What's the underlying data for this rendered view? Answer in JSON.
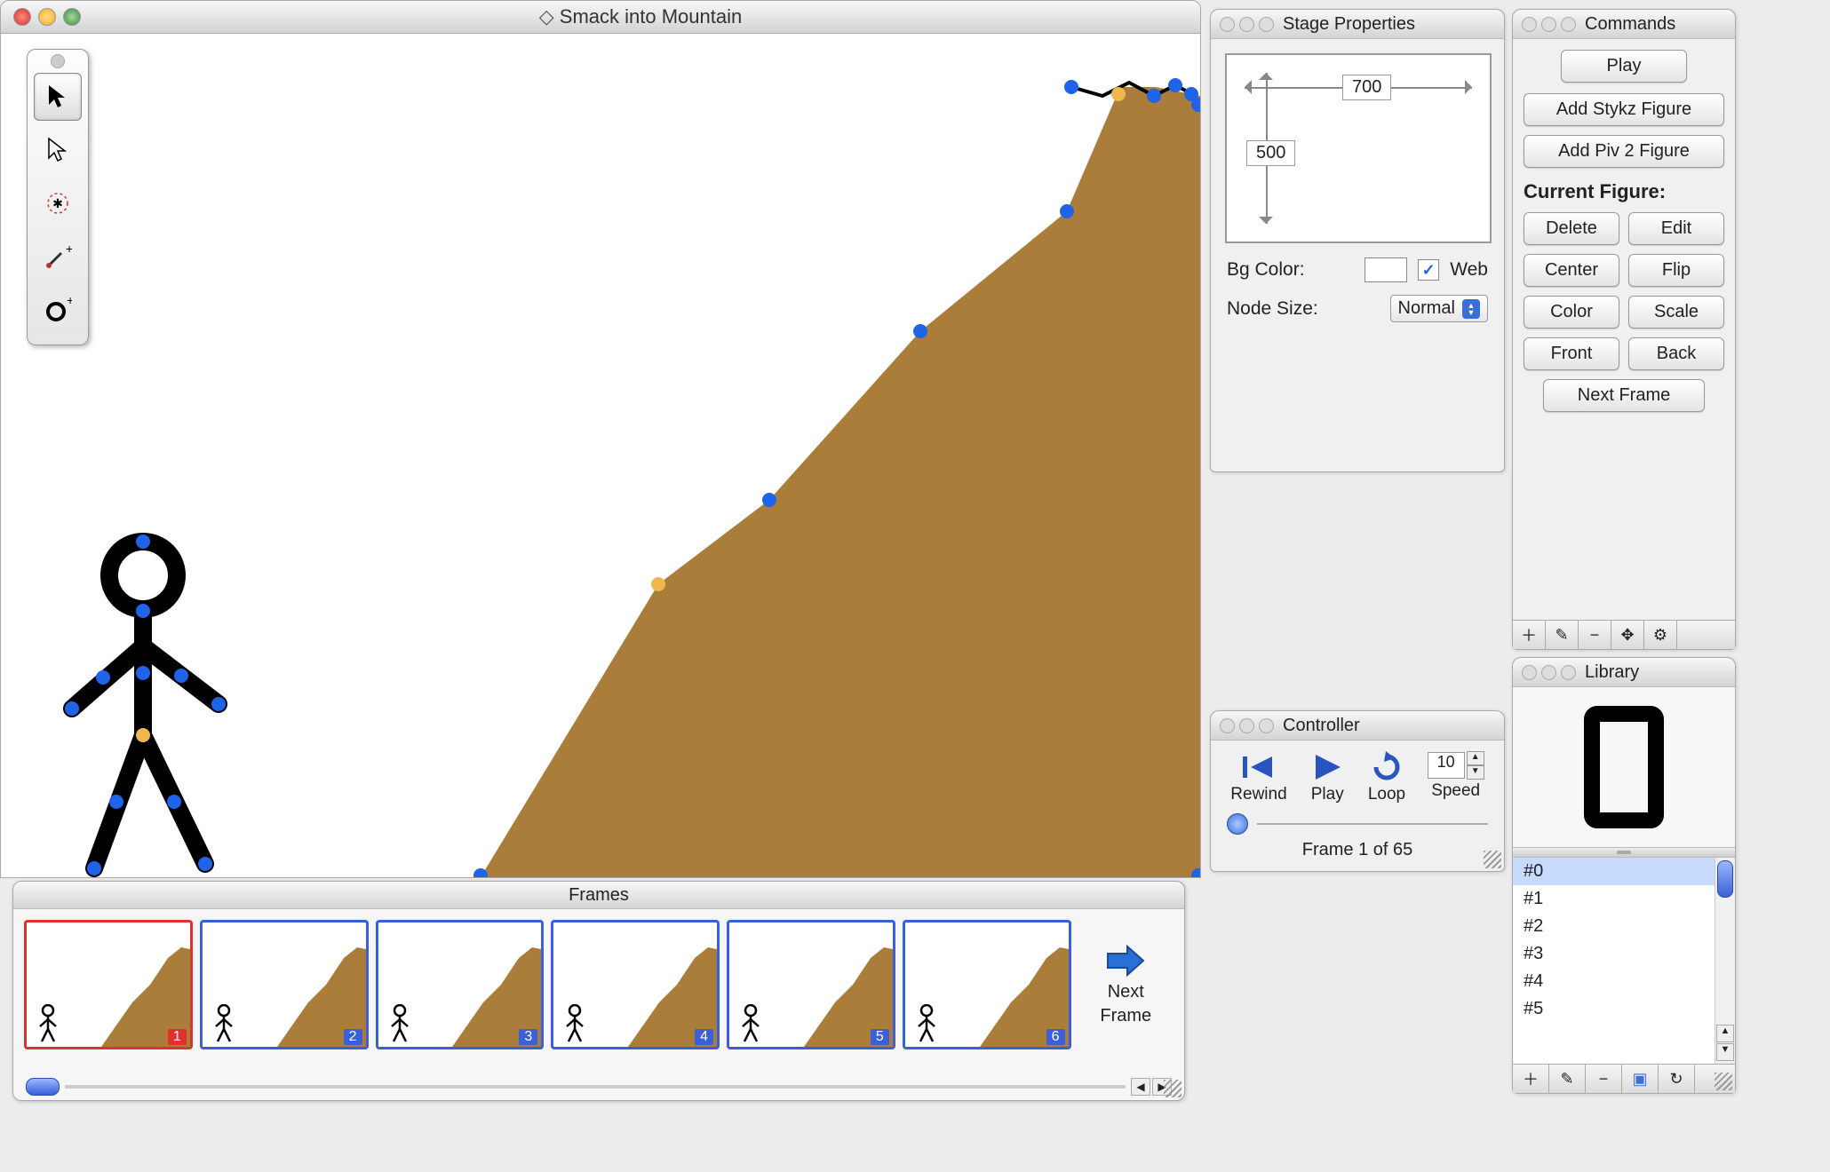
{
  "window": {
    "title": "Smack into Mountain"
  },
  "tools": [
    {
      "name": "arrow-filled",
      "selected": true
    },
    {
      "name": "arrow-outline",
      "selected": false
    },
    {
      "name": "target",
      "selected": false
    },
    {
      "name": "wand-add",
      "selected": false
    },
    {
      "name": "circle-add",
      "selected": false
    }
  ],
  "frames": {
    "title": "Frames",
    "next_label_1": "Next",
    "next_label_2": "Frame",
    "items": [
      {
        "num": "1",
        "active": true
      },
      {
        "num": "2",
        "active": false
      },
      {
        "num": "3",
        "active": false
      },
      {
        "num": "4",
        "active": false
      },
      {
        "num": "5",
        "active": false
      },
      {
        "num": "6",
        "active": false
      }
    ]
  },
  "stage_props": {
    "title": "Stage Properties",
    "width": "700",
    "height": "500",
    "bg_color_label": "Bg Color:",
    "web_label": "Web",
    "web_checked": true,
    "node_size_label": "Node Size:",
    "node_size_value": "Normal"
  },
  "controller": {
    "title": "Controller",
    "rewind": "Rewind",
    "play": "Play",
    "loop": "Loop",
    "speed_label": "Speed",
    "speed_value": "10",
    "status": "Frame 1 of 65"
  },
  "commands": {
    "title": "Commands",
    "play": "Play",
    "add_stykz": "Add Stykz Figure",
    "add_piv2": "Add Piv 2 Figure",
    "current_figure": "Current Figure:",
    "delete": "Delete",
    "edit": "Edit",
    "center": "Center",
    "flip": "Flip",
    "color": "Color",
    "scale": "Scale",
    "front": "Front",
    "back": "Back",
    "next_frame": "Next Frame"
  },
  "library": {
    "title": "Library",
    "items": [
      "#0",
      "#1",
      "#2",
      "#3",
      "#4",
      "#5"
    ],
    "selected": 0
  }
}
